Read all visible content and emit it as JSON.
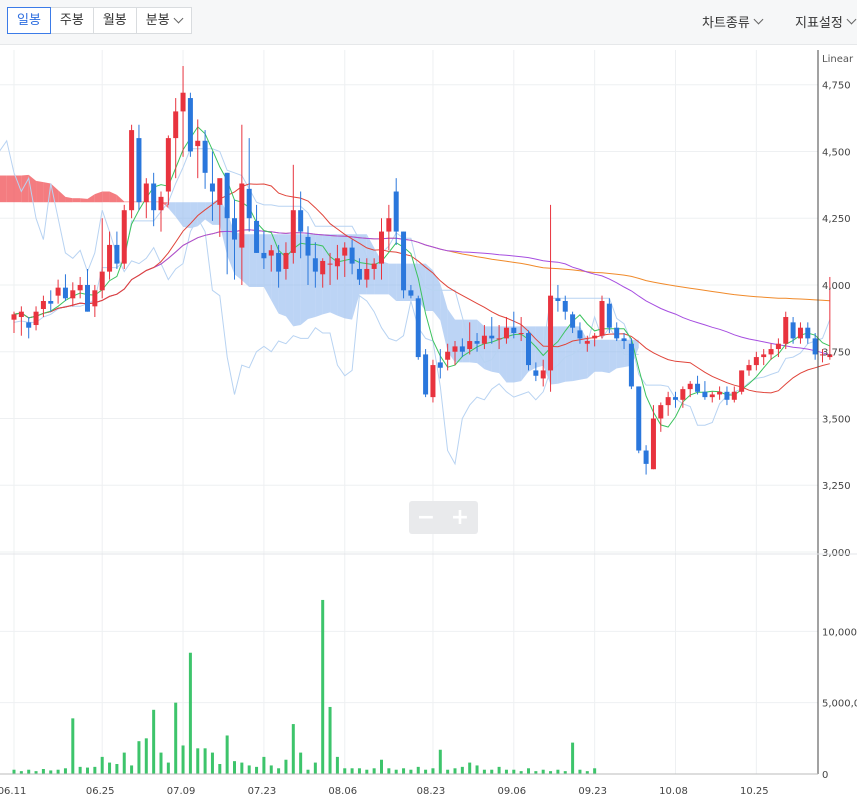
{
  "toolbar": {
    "tabs": [
      {
        "label": "일봉",
        "active": true
      },
      {
        "label": "주봉",
        "active": false
      },
      {
        "label": "월봉",
        "active": false
      },
      {
        "label": "분봉",
        "active": false,
        "dropdown": true
      }
    ],
    "chart_type_label": "차트종류",
    "indicator_settings_label": "지표설정"
  },
  "zoom": {
    "minus_icon": "minus-icon",
    "plus_icon": "plus-icon"
  },
  "colors": {
    "up": "#e8333e",
    "down": "#2a77dc",
    "volume": "#3dc46b",
    "ma5": "#3cc35e",
    "ma20": "#e0443a",
    "ma60": "#a64ee0",
    "ma120": "#f08a2a",
    "cloud_bull": "#f15b60",
    "cloud_bear": "#8fb8ee"
  },
  "chart_data": [
    {
      "type": "candlestick",
      "scale_label": "Linear",
      "ylim": [
        3000,
        4850
      ],
      "yticks": [
        "3,000",
        "3,250",
        "3,500",
        "3,750",
        "4,000",
        "4,250",
        "4,500",
        "4,750"
      ],
      "xticks": [
        "06.11",
        "06.25",
        "07.09",
        "07.23",
        "08.06",
        "08.23",
        "09.06",
        "09.23",
        "10.08",
        "10.25"
      ],
      "xtick_index": [
        0,
        12,
        23,
        34,
        45,
        57,
        68,
        79,
        90,
        101
      ],
      "grid": true,
      "overlays": [
        "MA5",
        "MA20",
        "MA60",
        "MA120",
        "Ichimoku cloud"
      ],
      "ohlc": [
        [
          3870,
          3900,
          3820,
          3890
        ],
        [
          3880,
          3920,
          3810,
          3900
        ],
        [
          3860,
          3880,
          3800,
          3840
        ],
        [
          3850,
          3920,
          3830,
          3900
        ],
        [
          3910,
          3960,
          3880,
          3940
        ],
        [
          3940,
          3980,
          3900,
          3930
        ],
        [
          3960,
          4020,
          3930,
          3990
        ],
        [
          3990,
          4040,
          3940,
          3950
        ],
        [
          3950,
          4010,
          3920,
          3980
        ],
        [
          3980,
          4030,
          3950,
          4000
        ],
        [
          4000,
          4060,
          3900,
          3900
        ],
        [
          3920,
          4000,
          3880,
          3980
        ],
        [
          3980,
          4250,
          3950,
          4050
        ],
        [
          4050,
          4200,
          4020,
          4150
        ],
        [
          4150,
          4200,
          4060,
          4080
        ],
        [
          4080,
          4300,
          4060,
          4280
        ],
        [
          4280,
          4600,
          4250,
          4580
        ],
        [
          4550,
          4600,
          4280,
          4310
        ],
        [
          4310,
          4400,
          4250,
          4380
        ],
        [
          4380,
          4420,
          4220,
          4280
        ],
        [
          4280,
          4350,
          4200,
          4330
        ],
        [
          4350,
          4560,
          4300,
          4550
        ],
        [
          4550,
          4700,
          4400,
          4650
        ],
        [
          4650,
          4820,
          4480,
          4720
        ],
        [
          4700,
          4720,
          4480,
          4500
        ],
        [
          4520,
          4620,
          4400,
          4540
        ],
        [
          4540,
          4580,
          4360,
          4420
        ],
        [
          4380,
          4500,
          4240,
          4350
        ],
        [
          4300,
          4380,
          4180,
          4400
        ],
        [
          4420,
          4420,
          4040,
          4250
        ],
        [
          4250,
          4320,
          4020,
          4170
        ],
        [
          4140,
          4600,
          4000,
          4380
        ],
        [
          4360,
          4550,
          4200,
          4250
        ],
        [
          4240,
          4300,
          4120,
          4120
        ],
        [
          4120,
          4200,
          4060,
          4100
        ],
        [
          4110,
          4150,
          4050,
          4130
        ],
        [
          4120,
          4150,
          3990,
          4050
        ],
        [
          4060,
          4160,
          4020,
          4120
        ],
        [
          4120,
          4450,
          4080,
          4280
        ],
        [
          4280,
          4350,
          4100,
          4200
        ],
        [
          4180,
          4220,
          4000,
          4110
        ],
        [
          4100,
          4160,
          3990,
          4050
        ],
        [
          4040,
          4100,
          3990,
          4090
        ],
        [
          4080,
          4120,
          4000,
          4080
        ],
        [
          4070,
          4150,
          4020,
          4100
        ],
        [
          4110,
          4160,
          4030,
          4140
        ],
        [
          4140,
          4170,
          4040,
          4080
        ],
        [
          4060,
          4100,
          4000,
          4020
        ],
        [
          4020,
          4100,
          3990,
          4060
        ],
        [
          4060,
          4100,
          4020,
          4080
        ],
        [
          4080,
          4250,
          4020,
          4200
        ],
        [
          4200,
          4300,
          4130,
          4250
        ],
        [
          4350,
          4400,
          4150,
          4200
        ],
        [
          4200,
          4200,
          3950,
          3980
        ],
        [
          3980,
          4000,
          3950,
          3960
        ],
        [
          3950,
          3960,
          3720,
          3730
        ],
        [
          3740,
          3760,
          3580,
          3590
        ],
        [
          3580,
          3720,
          3560,
          3700
        ],
        [
          3710,
          3760,
          3650,
          3690
        ],
        [
          3720,
          3780,
          3680,
          3750
        ],
        [
          3750,
          3790,
          3700,
          3770
        ],
        [
          3770,
          3800,
          3730,
          3750
        ],
        [
          3760,
          3860,
          3740,
          3790
        ],
        [
          3790,
          3820,
          3750,
          3780
        ],
        [
          3780,
          3850,
          3760,
          3810
        ],
        [
          3810,
          3880,
          3780,
          3800
        ],
        [
          3800,
          3850,
          3760,
          3800
        ],
        [
          3800,
          3880,
          3780,
          3840
        ],
        [
          3840,
          3900,
          3800,
          3820
        ],
        [
          3820,
          3880,
          3790,
          3820
        ],
        [
          3820,
          3830,
          3680,
          3700
        ],
        [
          3680,
          3710,
          3640,
          3660
        ],
        [
          3650,
          3720,
          3620,
          3680
        ],
        [
          3680,
          4300,
          3600,
          3960
        ],
        [
          3950,
          4000,
          3900,
          3940
        ],
        [
          3940,
          3960,
          3870,
          3900
        ],
        [
          3890,
          3900,
          3820,
          3840
        ],
        [
          3830,
          3860,
          3780,
          3800
        ],
        [
          3780,
          3810,
          3750,
          3790
        ],
        [
          3800,
          3820,
          3770,
          3810
        ],
        [
          3810,
          3960,
          3800,
          3940
        ],
        [
          3930,
          3950,
          3820,
          3840
        ],
        [
          3840,
          3860,
          3790,
          3800
        ],
        [
          3800,
          3820,
          3760,
          3790
        ],
        [
          3780,
          3800,
          3610,
          3620
        ],
        [
          3620,
          3620,
          3370,
          3380
        ],
        [
          3380,
          3400,
          3290,
          3330
        ],
        [
          3310,
          3550,
          3310,
          3500
        ],
        [
          3500,
          3560,
          3450,
          3550
        ],
        [
          3550,
          3600,
          3510,
          3580
        ],
        [
          3580,
          3600,
          3540,
          3570
        ],
        [
          3570,
          3620,
          3540,
          3610
        ],
        [
          3610,
          3640,
          3580,
          3630
        ],
        [
          3630,
          3660,
          3590,
          3600
        ],
        [
          3600,
          3640,
          3570,
          3580
        ],
        [
          3580,
          3600,
          3560,
          3590
        ],
        [
          3590,
          3620,
          3570,
          3600
        ],
        [
          3600,
          3620,
          3550,
          3570
        ],
        [
          3570,
          3620,
          3560,
          3600
        ],
        [
          3600,
          3680,
          3590,
          3680
        ],
        [
          3680,
          3720,
          3660,
          3700
        ],
        [
          3700,
          3750,
          3680,
          3730
        ],
        [
          3730,
          3760,
          3700,
          3740
        ],
        [
          3740,
          3780,
          3720,
          3760
        ],
        [
          3760,
          3800,
          3730,
          3780
        ],
        [
          3780,
          3900,
          3760,
          3880
        ],
        [
          3860,
          3880,
          3780,
          3800
        ],
        [
          3800,
          3860,
          3780,
          3840
        ],
        [
          3840,
          3860,
          3780,
          3800
        ],
        [
          3800,
          3820,
          3720,
          3740
        ],
        [
          3740,
          3760,
          3710,
          3740
        ],
        [
          3730,
          4030,
          3720,
          3740
        ]
      ]
    },
    {
      "type": "bar",
      "title": "volume",
      "ylim": [
        0,
        15000000
      ],
      "yticks": [
        "0",
        "5,000,0",
        "10,000,0"
      ],
      "values": [
        300000,
        200000,
        300000,
        200000,
        350000,
        250000,
        300000,
        400000,
        3900000,
        500000,
        450000,
        500000,
        1200000,
        800000,
        700000,
        1500000,
        600000,
        2300000,
        2500000,
        4500000,
        1500000,
        800000,
        5000000,
        2000000,
        8500000,
        1800000,
        1800000,
        1500000,
        700000,
        2700000,
        900000,
        800000,
        600000,
        500000,
        1200000,
        600000,
        400000,
        1000000,
        3500000,
        1500000,
        300000,
        800000,
        12200000,
        4700000,
        1200000,
        400000,
        400000,
        400000,
        300000,
        400000,
        1000000,
        400000,
        300000,
        400000,
        300000,
        500000,
        300000,
        400000,
        1700000,
        300000,
        400000,
        500000,
        800000,
        600000,
        300000,
        300000,
        500000,
        300000,
        300000,
        200000,
        400000,
        200000,
        300000,
        200000,
        300000,
        200000,
        2200000,
        300000,
        200000,
        400000
      ]
    }
  ]
}
